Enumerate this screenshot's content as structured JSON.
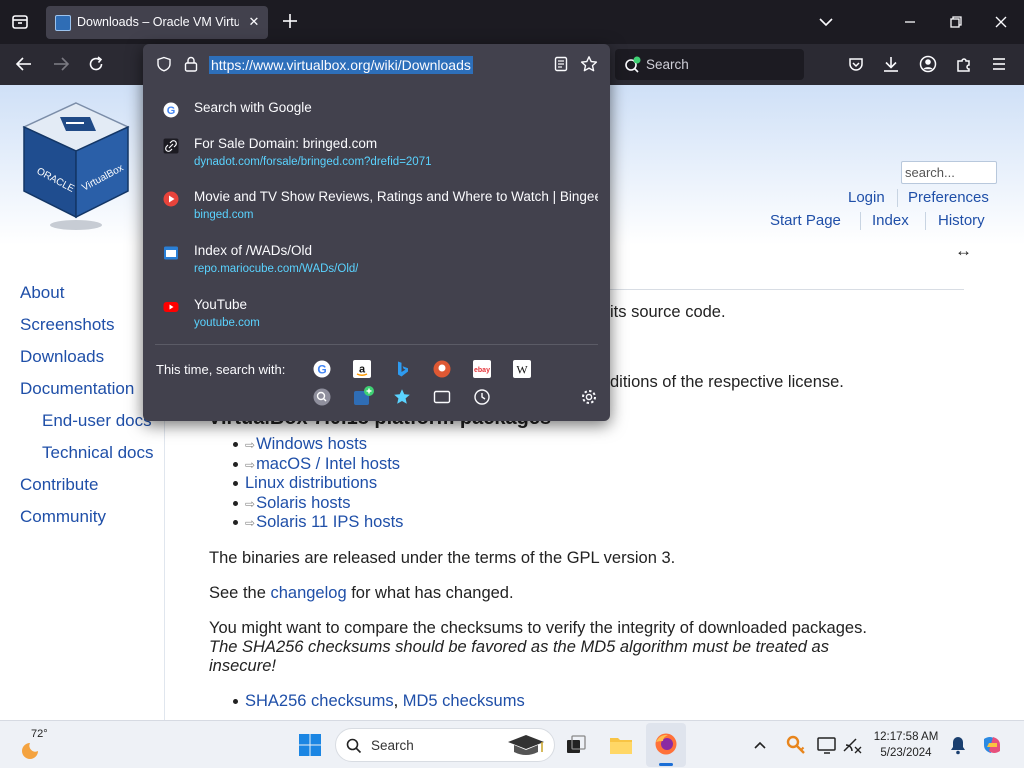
{
  "browser": {
    "tab_title": "Downloads – Oracle VM VirtualBox",
    "tab_close": "✕",
    "search_placeholder": "Search",
    "url": "https://www.virtualbox.org/wiki/Downloads"
  },
  "urlbar_popup": {
    "suggestions": [
      {
        "title": "Search with Google",
        "url": "",
        "icon": "google-icon"
      },
      {
        "title": "For Sale Domain: bringed.com",
        "url": "dynadot.com/forsale/bringed.com?drefid=2071",
        "icon": "link-icon"
      },
      {
        "title": "Movie and TV Show Reviews, Ratings and Where to Watch | Bingeed",
        "url": "binged.com",
        "icon": "play-icon"
      },
      {
        "title": "Index of /WADs/Old",
        "url": "repo.mariocube.com/WADs/Old/",
        "icon": "page-icon"
      },
      {
        "title": "YouTube",
        "url": "youtube.com",
        "icon": "youtube-icon"
      }
    ],
    "search_with_label": "This time, search with:",
    "engines": [
      "google",
      "amazon",
      "bing",
      "duckduckgo",
      "ebay",
      "wikipedia",
      "search-shortcuts",
      "add-engine",
      "bookmarks",
      "tabs",
      "history",
      "settings"
    ]
  },
  "page": {
    "search_placeholder": "search...",
    "top_links": {
      "login": "Login",
      "preferences": "Preferences",
      "start_page": "Start Page",
      "index": "Index",
      "history": "History"
    },
    "expand_icon": "↔",
    "sidebar": [
      "About",
      "Screenshots",
      "Downloads",
      "Documentation",
      "End-user docs",
      "Technical docs",
      "Contribute",
      "Community"
    ],
    "partial_text_1": "its source code.",
    "partial_text_2": "ditions of the respective license.",
    "heading_partial": "VirtualBox 7.0.18 platform packages",
    "platform_links": [
      "Windows hosts",
      "macOS / Intel hosts",
      "Linux distributions",
      "Solaris hosts",
      "Solaris 11 IPS hosts"
    ],
    "binaries_text": "The binaries are released under the terms of the GPL version 3.",
    "changelog_pre": "See the ",
    "changelog_link": "changelog",
    "changelog_post": " for what has changed.",
    "checksum_text": "You might want to compare the checksums to verify the integrity of downloaded packages.",
    "checksum_italic_1": "The SHA256 checksums should be favored as the MD5 algorithm must be treated as",
    "checksum_italic_2": "insecure!",
    "sha_link": "SHA256 checksums",
    "comma": ",",
    "md5_link": "MD5 checksums"
  },
  "taskbar": {
    "weather_temp": "72°",
    "search_label": "Search",
    "time": "12:17:58 AM",
    "date": "5/23/2024"
  },
  "colors": {
    "chrome_dark": "#1c1b22",
    "toolbar": "#2b2a33",
    "popup": "#42414d",
    "link_blue": "#1f4fa8",
    "url_highlight": "#2d6fba",
    "suggestion_url": "#5ad3ff"
  }
}
